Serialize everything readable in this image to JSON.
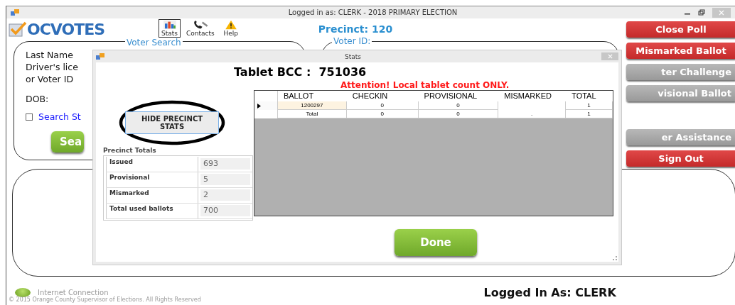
{
  "window": {
    "title": "Logged in as: CLERK - 2018 PRIMARY ELECTION"
  },
  "logo": {
    "text": "OCVOTES"
  },
  "toolbar": [
    {
      "label": "Stats",
      "selected": true
    },
    {
      "label": "Contacts",
      "selected": false
    },
    {
      "label": "Help",
      "selected": false
    }
  ],
  "precinct": "Precinct: 120",
  "voter_search": {
    "title": "Voter Search",
    "lines": [
      "Last Name",
      "Driver's lice",
      "or Voter ID"
    ],
    "dob_label": "DOB:",
    "search_option": {
      "label": "Search St",
      "checked": false
    },
    "search_button": "Sea"
  },
  "voter_panel": {
    "title": "Voter ID:"
  },
  "action_buttons": [
    {
      "label": "Close Poll",
      "disabled": false,
      "gap_before": false
    },
    {
      "label": "Mismarked Ballot",
      "disabled": false,
      "gap_before": false
    },
    {
      "label": "ter Challenge",
      "disabled": true,
      "gap_before": false
    },
    {
      "label": "visional Ballot",
      "disabled": true,
      "gap_before": false
    },
    {
      "label": "er Assistance",
      "disabled": true,
      "gap_before": true
    },
    {
      "label": "Sign Out",
      "disabled": false,
      "gap_before": false
    }
  ],
  "dialog": {
    "title": "Stats",
    "heading": "Tablet BCC :  751036",
    "attention": "Attention! Local tablet count ONLY.",
    "hide_button": "HIDE PRECINCT STATS",
    "totals": {
      "title": "Precinct Totals",
      "rows": [
        {
          "label": "Issued",
          "value": "693"
        },
        {
          "label": "Provisional",
          "value": "5"
        },
        {
          "label": "Mismarked",
          "value": "2"
        },
        {
          "label": "Total used ballots",
          "value": "700"
        }
      ]
    },
    "table": {
      "columns": [
        "BALLOT",
        "CHECKIN",
        "PROVISIONAL",
        "MISMARKED",
        "TOTAL"
      ],
      "rows": [
        {
          "current": true,
          "cells": [
            "1200297",
            "0",
            "0",
            null,
            "1"
          ]
        },
        {
          "current": false,
          "cells": [
            "Total",
            "0",
            "0",
            ".",
            "1"
          ]
        }
      ]
    },
    "done_button": "Done"
  },
  "status": {
    "label": "Internet Connection",
    "connected": true
  },
  "copyright": "© 2015 Orange County Supervisor of Elections. All Rights Reserved",
  "logged_in": "Logged In As: CLERK"
}
